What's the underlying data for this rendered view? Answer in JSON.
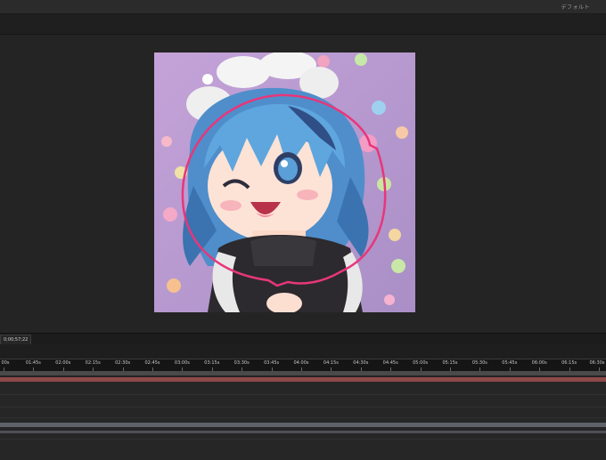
{
  "app": {
    "workspace_label": "デフォルト"
  },
  "viewer": {
    "timecode": "0;00;57;22"
  },
  "timeline": {
    "ruler_labels": [
      "00s",
      "01:45s",
      "02:00s",
      "02:15s",
      "02:30s",
      "02:45s",
      "03:00s",
      "03:15s",
      "03:30s",
      "03:45s",
      "04:00s",
      "04:15s",
      "04:30s",
      "04:45s",
      "05:00s",
      "05:15s",
      "05:30s",
      "05:45s",
      "06:00s",
      "06:15s",
      "06:30s"
    ]
  },
  "colors": {
    "background": "#232323",
    "comp_background": "#b89ccd",
    "mask_outline": "#e8367a",
    "timeline_red_bar": "#8f4a48",
    "hair": "#5aa0d6"
  }
}
